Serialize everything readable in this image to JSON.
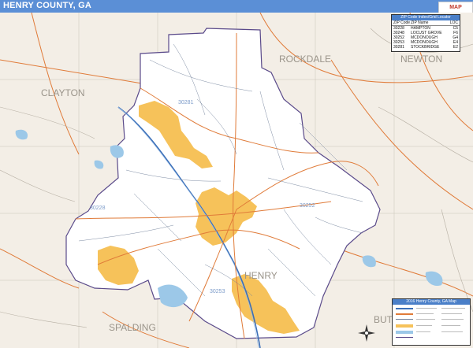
{
  "title": "HENRY COUNTY, GA",
  "labels": {
    "clayton": "CLAYTON",
    "rockdale": "ROCKDALE",
    "newton": "NEWTON",
    "spalding": "SPALDING",
    "henry": "HENRY",
    "butts": "BUTTS",
    "zip_30281": "30281",
    "zip_30253": "30253",
    "zip_30252": "30252",
    "zip_30228": "30228"
  },
  "zip_locator": {
    "heading": "ZIP Code Index/Grid Locator",
    "columns": [
      "ZIP Code",
      "ZIP Name",
      "LOC"
    ],
    "rows": [
      [
        "30228",
        "HAMPTON",
        "C5"
      ],
      [
        "30248",
        "LOCUST GROVE",
        "F6"
      ],
      [
        "30252",
        "MCDONOUGH",
        "G4"
      ],
      [
        "30253",
        "MCDONOUGH",
        "E4"
      ],
      [
        "30281",
        "STOCKBRIDGE",
        "E2"
      ]
    ]
  },
  "legend": {
    "heading": "2016 Henry County, GA Map"
  },
  "colors": {
    "title_bar": "#5b8fd6",
    "county_fill": "#ffffff",
    "outside_fill": "#f3eee6",
    "urban": "#f6c25a",
    "water": "#9cc8e8",
    "highway": "#e07b39",
    "interstate": "#3b6fb8",
    "road": "#6f7f99"
  }
}
